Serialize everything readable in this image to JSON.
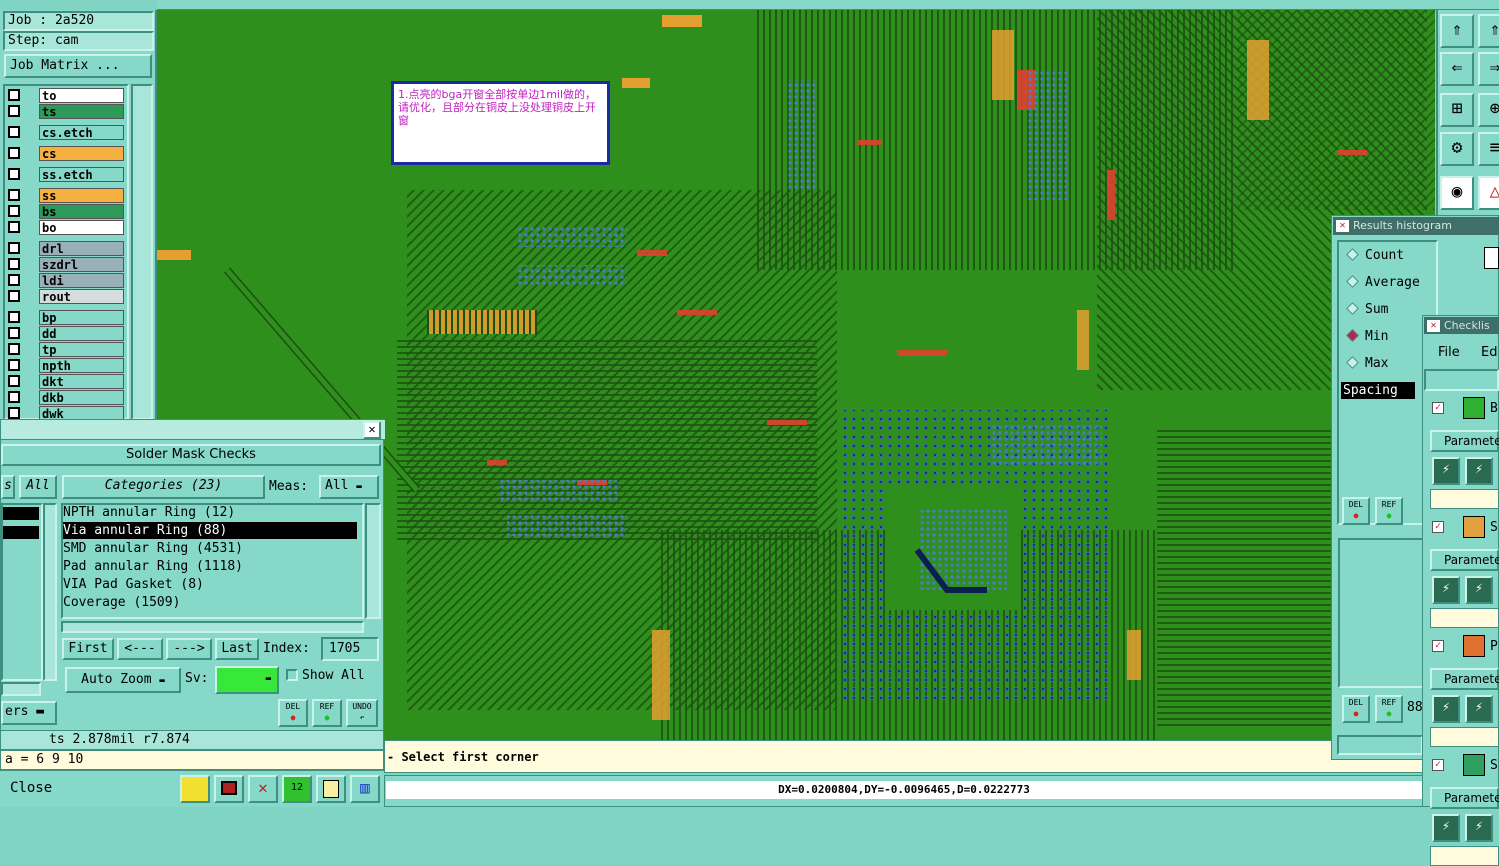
{
  "job": {
    "job_label": "Job : 2a520",
    "step_label": "Step: cam",
    "matrix_button": "Job Matrix ..."
  },
  "layers": [
    {
      "name": "to",
      "color": "#ffffff"
    },
    {
      "name": "ts",
      "color": "#2e9a5a"
    },
    {
      "name": "cs.etch",
      "color": "#86d8c8"
    },
    {
      "name": "cs",
      "color": "#f6b040"
    },
    {
      "name": "ss.etch",
      "color": "#86d8c8"
    },
    {
      "name": "ss",
      "color": "#f6b040"
    },
    {
      "name": "bs",
      "color": "#2e9a5a"
    },
    {
      "name": "bo",
      "color": "#ffffff"
    },
    {
      "name": "drl",
      "color": "#9ab0b8"
    },
    {
      "name": "szdrl",
      "color": "#9ab0b8"
    },
    {
      "name": "ldi",
      "color": "#9ab0b8"
    },
    {
      "name": "rout",
      "color": "#d4dcdc"
    },
    {
      "name": "bp",
      "color": "#86d8c8"
    },
    {
      "name": "dd",
      "color": "#86d8c8"
    },
    {
      "name": "tp",
      "color": "#86d8c8"
    },
    {
      "name": "npth",
      "color": "#86d8c8"
    },
    {
      "name": "dkt",
      "color": "#86d8c8"
    },
    {
      "name": "dkb",
      "color": "#86d8c8"
    },
    {
      "name": "dwk",
      "color": "#86d8c8"
    }
  ],
  "annotation": {
    "text": "1.点亮的bga开窗全部按单边1mil做的，请优化，且部分在铜皮上没处理铜皮上开窗"
  },
  "solder_mask": {
    "close_x": "✕",
    "title": "Solder Mask Checks",
    "left_tab_s": "s",
    "left_tab_all": "All",
    "categories_label": "Categories (23)",
    "meas_label": "Meas:",
    "meas_value": "All",
    "categories": [
      "NPTH annular Ring (12)",
      "Via annular Ring (88)",
      "SMD annular Ring (4531)",
      "Pad annular Ring (1118)",
      "VIA Pad Gasket (8)",
      "Coverage (1509)"
    ],
    "selected_index": 1,
    "first": "First",
    "prev": "<---",
    "next": "--->",
    "last": "Last",
    "index_label": "Index:",
    "index_value": "1705",
    "auto_zoom": "Auto Zoom",
    "sv_label": "Sv:",
    "show_all": "Show All",
    "ers_label": "ers",
    "del": "DEL",
    "ref": "REF",
    "undo": "UNDO"
  },
  "status": {
    "ts_info": "ts 2.878mil  r7.874",
    "cmd_line": "a = 6 9 10",
    "close": "Close",
    "prompt": "- Select first corner",
    "coords": "DX=0.0200804,DY=-0.0096465,D=0.0222773"
  },
  "results_histogram": {
    "title": "Results histogram",
    "options": [
      "Count",
      "Average",
      "Sum",
      "Min",
      "Max"
    ],
    "selected": "Min",
    "field": "Spacing",
    "del": "DEL",
    "ref": "REF",
    "count_partial": "88"
  },
  "checklist": {
    "title": "Checklis",
    "menu_file": "File",
    "menu_edit": "Ed",
    "row_letters": [
      "B",
      "S",
      "P",
      "S"
    ],
    "param_label": "Paramete"
  },
  "colors": {
    "board": "#2f8f1c",
    "trace": "#1d4f12",
    "pad": "#e3a030",
    "highlight": "#e04030",
    "bga": "#3060b0"
  }
}
